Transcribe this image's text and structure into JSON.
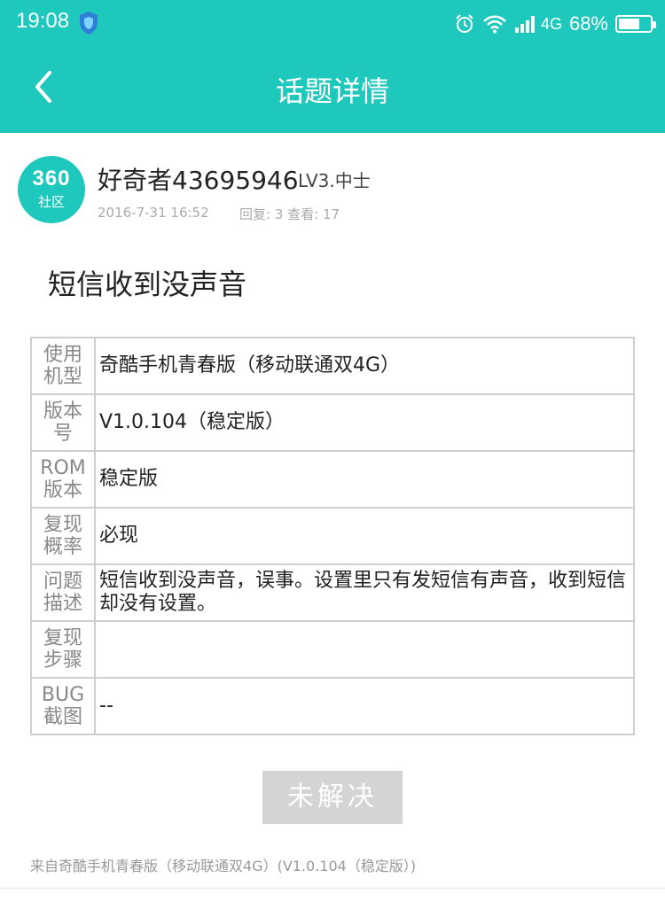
{
  "status_bar": {
    "time": "19:08",
    "network": "4G",
    "battery_text": "68%",
    "battery_level": 0.68
  },
  "header": {
    "title": "话题详情"
  },
  "author": {
    "avatar_top": "360",
    "avatar_bottom": "社区",
    "name": "好奇者43695946",
    "level": "LV3.中士",
    "date": "2016-7-31 16:52",
    "stats": "回复: 3 查看: 17"
  },
  "post": {
    "title": "短信收到没声音"
  },
  "table": [
    {
      "k1": "使用",
      "k2": "机型",
      "value": "奇酷手机青春版（移动联通双4G）"
    },
    {
      "k1": "版本",
      "k2": "号",
      "value": "V1.0.104（稳定版）"
    },
    {
      "k1": "ROM",
      "k2": "版本",
      "value": "稳定版"
    },
    {
      "k1": "复现",
      "k2": "概率",
      "value": "必现"
    },
    {
      "k1": "问题",
      "k2": "描述",
      "value": "短信收到没声音，误事。设置里只有发短信有声音，收到短信却没有设置。"
    },
    {
      "k1": "复现",
      "k2": "步骤",
      "value": ""
    },
    {
      "k1": "BUG",
      "k2": "截图",
      "value": "--"
    }
  ],
  "status_button": "未解决",
  "source": "来自奇酷手机青春版（移动联通双4G）(V1.0.104（稳定版）)",
  "colors": {
    "accent": "#1ec8bc",
    "button_disabled": "#d4d4d4"
  }
}
